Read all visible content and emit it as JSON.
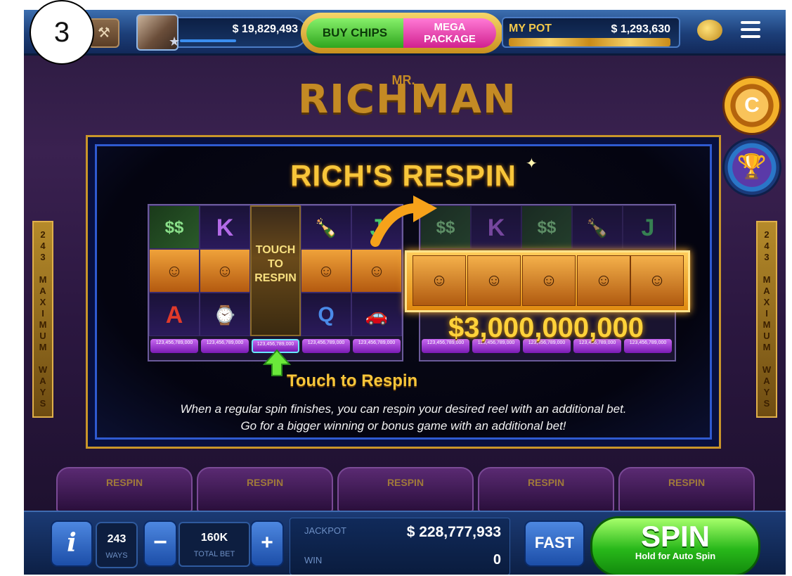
{
  "step_number": "3",
  "top_bar": {
    "balance": "$ 19,829,493",
    "buy_chips": "BUY CHIPS",
    "mega_package_line1": "MEGA",
    "mega_package_line2": "PACKAGE",
    "my_pot_label": "MY POT",
    "my_pot_value": "$ 1,293,630"
  },
  "background_game": {
    "title_small": "MR.",
    "title": "RICHMAN",
    "side_banner": "243 MAXIMUM WAYS",
    "respin_tabs": [
      "RESPIN",
      "RESPIN",
      "RESPIN",
      "RESPIN",
      "RESPIN"
    ]
  },
  "dialog": {
    "title": "RICH'S RESPIN",
    "touch_column_text": [
      "TOUCH",
      "TO",
      "RESPIN"
    ],
    "big_win": "$3,000,000,000",
    "touch_to_respin": "Touch to Respin",
    "description_line1": "When a regular spin finishes, you can respin your desired reel with an additional bet.",
    "description_line2": "Go for a bigger winning or bonus game with an additional bet!",
    "price_tag_label": "123,456,789,000"
  },
  "bottom_bar": {
    "info_icon": "i",
    "ways_value": "243",
    "ways_label": "WAYS",
    "total_bet_value": "160K",
    "total_bet_label": "TOTAL BET",
    "jackpot_label": "JACKPOT",
    "jackpot_value": "$ 228,777,933",
    "win_label": "WIN",
    "win_value": "0",
    "fast": "FAST",
    "spin": "SPIN",
    "spin_sub": "Hold for Auto Spin"
  },
  "icons": {
    "minus": "−",
    "plus": "+",
    "coin": "C",
    "trophy": "🏆",
    "star": "★"
  },
  "colors": {
    "accent_gold": "#f8c63a",
    "spin_green": "#28b81a",
    "mega_pink": "#d1218f",
    "bar_blue": "#1c3e78"
  }
}
